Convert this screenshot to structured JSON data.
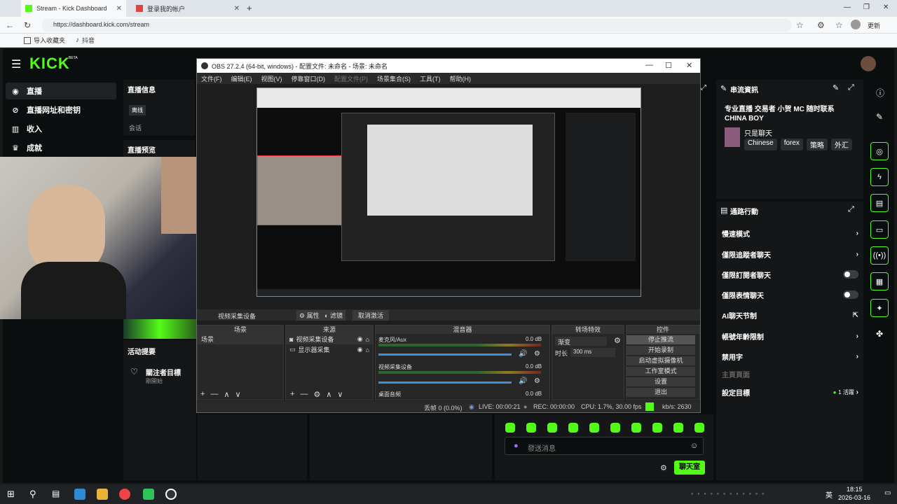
{
  "browser": {
    "tabs": [
      {
        "title": "Stream - Kick Dashboard",
        "active": true
      },
      {
        "title": "登录我的帐户",
        "active": false
      }
    ],
    "url": "https://dashboard.kick.com/stream",
    "bookmarks": [
      "导入收藏夹",
      "抖音"
    ],
    "profile_label": "更新"
  },
  "kick": {
    "logo": "KICK",
    "logo_badge": "BETA",
    "sidebar": [
      {
        "label": "直播",
        "icon": "broadcast-icon"
      },
      {
        "label": "直播网址和密钥",
        "icon": "link-icon"
      },
      {
        "label": "收入",
        "icon": "chart-icon"
      },
      {
        "label": "成就",
        "icon": "trophy-icon"
      }
    ],
    "stream_info_title": "直播信息",
    "offline_label": "离线",
    "session_label": "会话",
    "preview_title": "直播预览",
    "activity_title": "活动提要",
    "follower_goal_title": "關注者目標",
    "follower_goal_status": "剛開始",
    "stream_panel_title": "串流資訊",
    "stream_title": "专业直播 交易者 小贺 MC 随时联系 CHINA BOY",
    "category": "只是聊天",
    "tags": [
      "Chinese",
      "forex",
      "策略",
      "外汇"
    ],
    "channel_actions_title": "通路行動",
    "actions": [
      {
        "label": "慢速模式",
        "control": "chevron"
      },
      {
        "label": "僅限追蹤者聊天",
        "control": "chevron"
      },
      {
        "label": "僅限訂閱者聊天",
        "control": "toggle"
      },
      {
        "label": "僅限表情聊天",
        "control": "toggle"
      },
      {
        "label": "AI聊天节制",
        "control": "external"
      },
      {
        "label": "帳號年齡限制",
        "control": "chevron"
      },
      {
        "label": "禁用字",
        "control": "chevron"
      },
      {
        "label": "主頁頁面",
        "control": "none"
      },
      {
        "label": "設定目標",
        "control": "chevron",
        "extra": "1 活躍"
      }
    ],
    "chat_placeholder": "發送消息",
    "chat_button": "聊天室"
  },
  "obs": {
    "title": "OBS 27.2.4 (64-bit, windows) - 配置文件: 未命名 - 场景: 未命名",
    "menu": [
      "文件(F)",
      "编辑(E)",
      "视图(V)",
      "停靠窗口(D)",
      "配置文件(P)",
      "场景集合(S)",
      "工具(T)",
      "帮助(H)"
    ],
    "source_toolbar": {
      "source": "视频采集设备",
      "properties": "属性",
      "filters": "滤镜",
      "deactivate": "取消激活"
    },
    "docks": {
      "scenes": "场景",
      "sources": "来源",
      "mixer": "混音器",
      "transitions": "转场特效",
      "controls": "控件"
    },
    "scenes": [
      "场景"
    ],
    "sources": [
      "视频采集设备",
      "显示器采集"
    ],
    "mixer": [
      {
        "name": "麦克风/Aux",
        "db": "0.0 dB"
      },
      {
        "name": "视频采集设备",
        "db": "0.0 dB"
      },
      {
        "name": "桌面音频",
        "db": "0.0 dB"
      }
    ],
    "transition": {
      "type": "渐变",
      "duration_label": "时长",
      "duration": "300 ms"
    },
    "controls": [
      "停止推流",
      "开始录制",
      "启动虚拟摄像机",
      "工作室模式",
      "设置",
      "退出"
    ],
    "status": {
      "dropped": "丢帧 0 (0.0%)",
      "live": "LIVE: 00:00:21",
      "rec": "REC: 00:00:00",
      "cpu": "CPU: 1.7%, 30.00 fps",
      "kbps": "kb/s: 2630"
    }
  },
  "taskbar": {
    "time": "18:15",
    "date": "2026-03-16",
    "lang": "英"
  },
  "colors": {
    "kick_green": "#53fc18",
    "obs_bg": "#1e1e1e",
    "kick_bg": "#0b0e0f"
  }
}
